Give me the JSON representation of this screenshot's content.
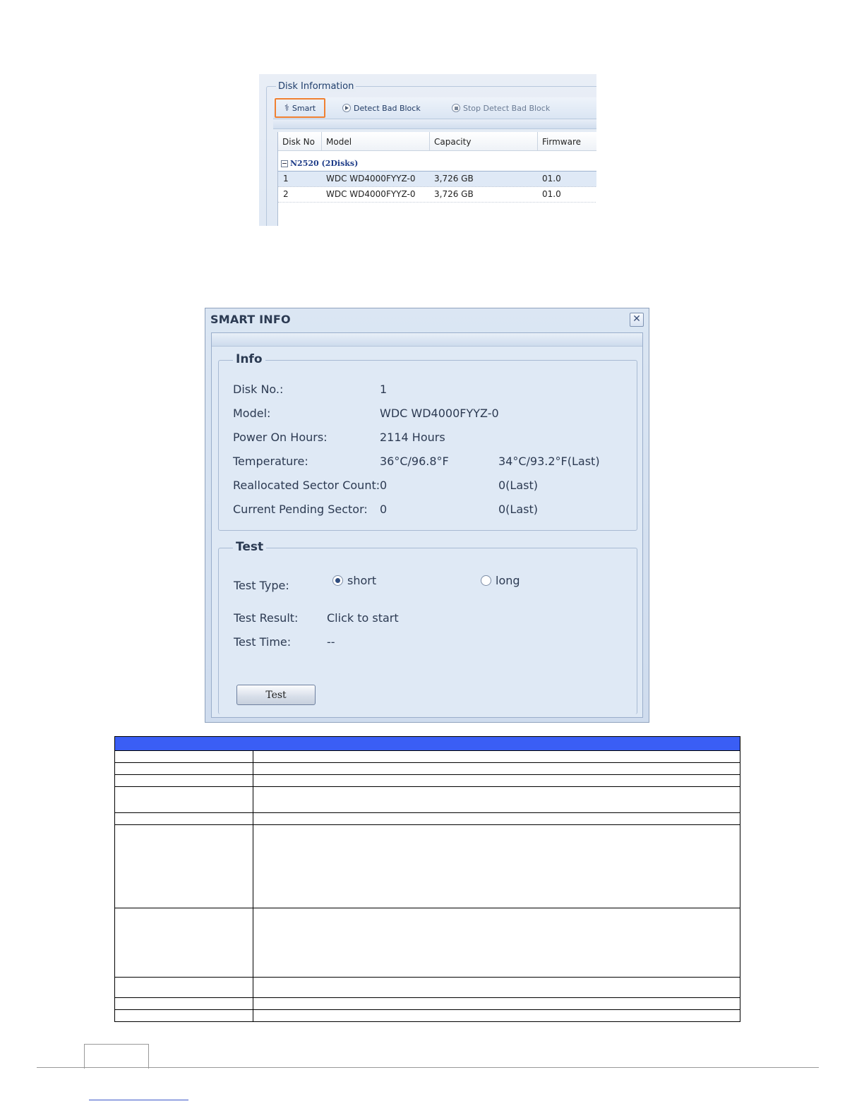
{
  "disk_info": {
    "title": "Disk Information",
    "toolbar": {
      "smart": "Smart",
      "detect": "Detect Bad Block",
      "stop": "Stop Detect Bad Block"
    },
    "columns": [
      "Disk No",
      "Model",
      "Capacity",
      "Firmware"
    ],
    "group": "N2520 (2Disks)",
    "rows": [
      {
        "no": "1",
        "model": "WDC WD4000FYYZ-0",
        "capacity": "3,726 GB",
        "firmware": "01.0"
      },
      {
        "no": "2",
        "model": "WDC WD4000FYYZ-0",
        "capacity": "3,726 GB",
        "firmware": "01.0"
      }
    ]
  },
  "smart_dialog": {
    "title": "SMART INFO",
    "close": "✕",
    "info": {
      "legend": "Info",
      "disk_no_label": "Disk No.:",
      "disk_no": "1",
      "model_label": "Model:",
      "model": "WDC WD4000FYYZ-0",
      "hours_label": "Power On Hours:",
      "hours": "2114 Hours",
      "temp_label": "Temperature:",
      "temp": "36°C/96.8°F",
      "temp_last": "34°C/93.2°F(Last)",
      "realloc_label": "Reallocated Sector Count:",
      "realloc": "0",
      "realloc_last": "0(Last)",
      "pending_label": "Current Pending Sector:",
      "pending": "0",
      "pending_last": "0(Last)"
    },
    "test": {
      "legend": "Test",
      "type_label": "Test Type:",
      "short": "short",
      "long": "long",
      "selected": "short",
      "result_label": "Test Result:",
      "result": "Click to start",
      "time_label": "Test Time:",
      "time": "--",
      "button": "Test"
    }
  },
  "colors": {
    "table_header": "#3a5ef5",
    "highlight": "#f08031"
  }
}
